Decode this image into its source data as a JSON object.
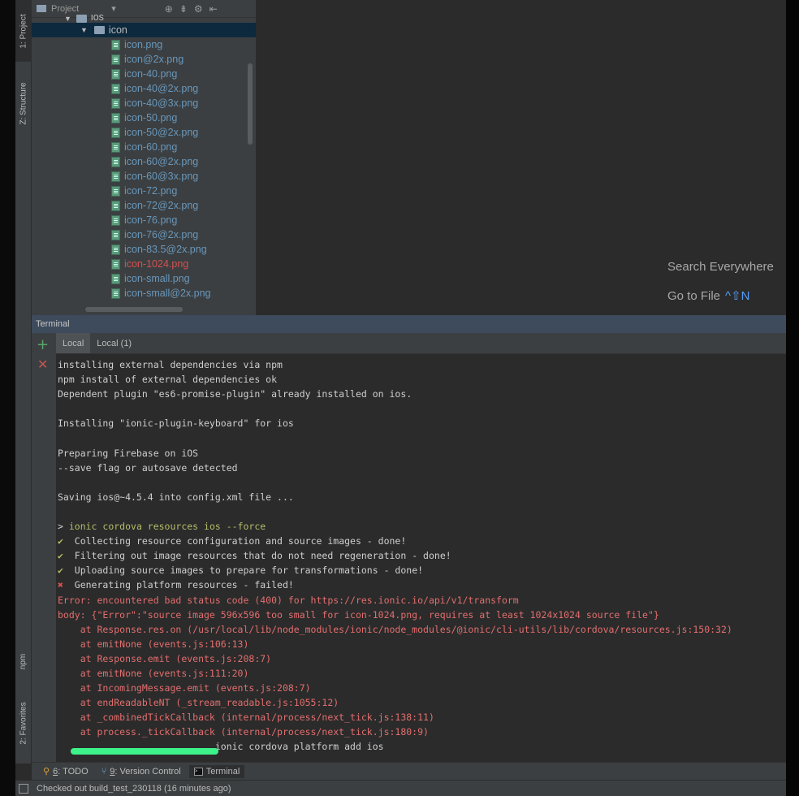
{
  "left_tabs": {
    "project": "1: Project",
    "structure": "Z: Structure",
    "npm": "npm",
    "favorites": "2: Favorites"
  },
  "project_panel": {
    "title": "Project",
    "parent_folder": "ios",
    "folder": "icon",
    "files": [
      {
        "name": "icon.png",
        "color": "#6897bb"
      },
      {
        "name": "icon@2x.png",
        "color": "#6897bb"
      },
      {
        "name": "icon-40.png",
        "color": "#6897bb"
      },
      {
        "name": "icon-40@2x.png",
        "color": "#6897bb"
      },
      {
        "name": "icon-40@3x.png",
        "color": "#6897bb"
      },
      {
        "name": "icon-50.png",
        "color": "#6897bb"
      },
      {
        "name": "icon-50@2x.png",
        "color": "#6897bb"
      },
      {
        "name": "icon-60.png",
        "color": "#6897bb"
      },
      {
        "name": "icon-60@2x.png",
        "color": "#6897bb"
      },
      {
        "name": "icon-60@3x.png",
        "color": "#6897bb"
      },
      {
        "name": "icon-72.png",
        "color": "#6897bb"
      },
      {
        "name": "icon-72@2x.png",
        "color": "#6897bb"
      },
      {
        "name": "icon-76.png",
        "color": "#6897bb"
      },
      {
        "name": "icon-76@2x.png",
        "color": "#6897bb"
      },
      {
        "name": "icon-83.5@2x.png",
        "color": "#6897bb"
      },
      {
        "name": "icon-1024.png",
        "color": "#d25252"
      },
      {
        "name": "icon-small.png",
        "color": "#6897bb"
      },
      {
        "name": "icon-small@2x.png",
        "color": "#6897bb"
      }
    ]
  },
  "editor_hints": {
    "search_everywhere": "Search Everywhere",
    "go_to_file": "Go to File",
    "go_to_file_shortcut": "^⇧N"
  },
  "terminal": {
    "title": "Terminal",
    "tabs": [
      "Local",
      "Local (1)"
    ],
    "lines": [
      {
        "kind": "plain",
        "text": "installing external dependencies via npm"
      },
      {
        "kind": "plain",
        "text": "npm install of external dependencies ok"
      },
      {
        "kind": "plain",
        "text": "Dependent plugin \"es6-promise-plugin\" already installed on ios."
      },
      {
        "kind": "plain",
        "text": ""
      },
      {
        "kind": "plain",
        "text": "Installing \"ionic-plugin-keyboard\" for ios"
      },
      {
        "kind": "plain",
        "text": ""
      },
      {
        "kind": "plain",
        "text": "Preparing Firebase on iOS"
      },
      {
        "kind": "plain",
        "text": "--save flag or autosave detected"
      },
      {
        "kind": "plain",
        "text": ""
      },
      {
        "kind": "plain",
        "text": "Saving ios@~4.5.4 into config.xml file ..."
      },
      {
        "kind": "plain",
        "text": ""
      },
      {
        "kind": "cmd",
        "prefix": "> ",
        "text": "ionic cordova resources ios --force"
      },
      {
        "kind": "ok",
        "mark": "✔",
        "text": "  Collecting resource configuration and source images - done!"
      },
      {
        "kind": "ok",
        "mark": "✔",
        "text": "  Filtering out image resources that do not need regeneration - done!"
      },
      {
        "kind": "ok",
        "mark": "✔",
        "text": "  Uploading source images to prepare for transformations - done!"
      },
      {
        "kind": "fail",
        "mark": "✖",
        "text": "  Generating platform resources - failed!"
      },
      {
        "kind": "err",
        "text": "Error: encountered bad status code (400) for https://res.ionic.io/api/v1/transform"
      },
      {
        "kind": "err",
        "text": "body: {\"Error\":\"source image 596x596 too small for icon-1024.png, requires at least 1024x1024 source file\"}"
      },
      {
        "kind": "err",
        "text": "    at Response.res.on (/usr/local/lib/node_modules/ionic/node_modules/@ionic/cli-utils/lib/cordova/resources.js:150:32)"
      },
      {
        "kind": "err",
        "text": "    at emitNone (events.js:106:13)"
      },
      {
        "kind": "err",
        "text": "    at Response.emit (events.js:208:7)"
      },
      {
        "kind": "err",
        "text": "    at emitNone (events.js:111:20)"
      },
      {
        "kind": "err",
        "text": "    at IncomingMessage.emit (events.js:208:7)"
      },
      {
        "kind": "err",
        "text": "    at endReadableNT (_stream_readable.js:1055:12)"
      },
      {
        "kind": "err",
        "text": "    at _combinedTickCallback (internal/process/next_tick.js:138:11)"
      },
      {
        "kind": "err",
        "text": "    at process._tickCallback (internal/process/next_tick.js:180:9)"
      },
      {
        "kind": "plain",
        "text": "                            ionic cordova platform add ios"
      }
    ]
  },
  "bottom_tabs": [
    {
      "key": "6",
      "label": ": TODO",
      "icon": "todo-icon"
    },
    {
      "key": "9",
      "label": ": Version Control",
      "icon": "branch-icon"
    },
    {
      "key": "",
      "label": "Terminal",
      "icon": "terminal-icon"
    }
  ],
  "status_bar": {
    "message": "Checked out build_test_230118 (16 minutes ago)"
  }
}
